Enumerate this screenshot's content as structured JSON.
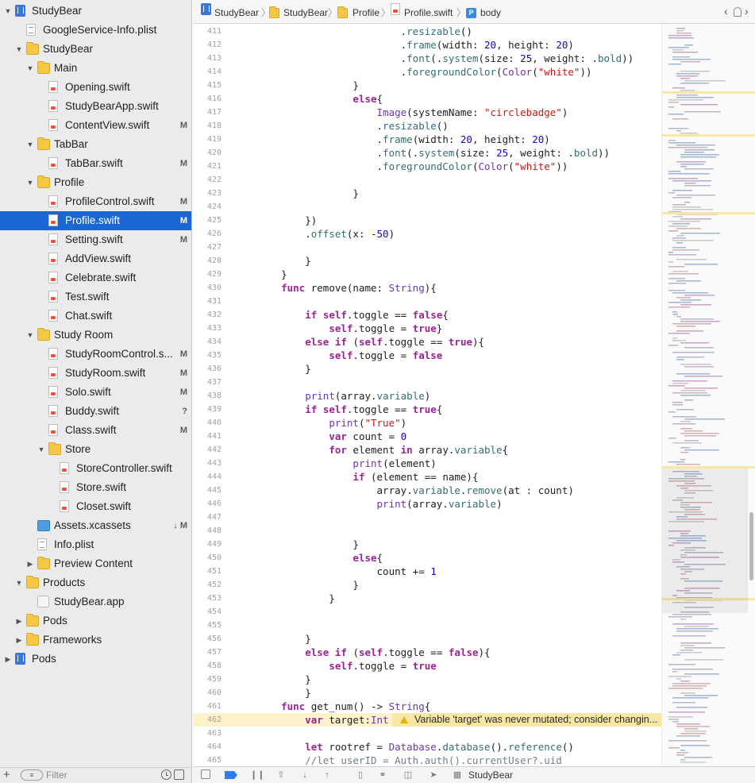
{
  "navigator": {
    "items": [
      {
        "label": "StudyBear",
        "icon": "project-icon",
        "status": "",
        "depth": 0,
        "disclosure": "open"
      },
      {
        "label": "GoogleService-Info.plist",
        "icon": "plist-icon",
        "status": "",
        "depth": 1,
        "disclosure": "none"
      },
      {
        "label": "StudyBear",
        "icon": "folder-icon",
        "status": "",
        "depth": 1,
        "disclosure": "open"
      },
      {
        "label": "Main",
        "icon": "folder-icon",
        "status": "",
        "depth": 2,
        "disclosure": "open"
      },
      {
        "label": "Opening.swift",
        "icon": "swift-file-icon",
        "status": "",
        "depth": 3,
        "disclosure": "none"
      },
      {
        "label": "StudyBearApp.swift",
        "icon": "swift-file-icon",
        "status": "",
        "depth": 3,
        "disclosure": "none"
      },
      {
        "label": "ContentView.swift",
        "icon": "swift-file-icon",
        "status": "M",
        "depth": 3,
        "disclosure": "none"
      },
      {
        "label": "TabBar",
        "icon": "folder-icon",
        "status": "",
        "depth": 2,
        "disclosure": "open"
      },
      {
        "label": "TabBar.swift",
        "icon": "swift-file-icon",
        "status": "M",
        "depth": 3,
        "disclosure": "none"
      },
      {
        "label": "Profile",
        "icon": "folder-icon",
        "status": "",
        "depth": 2,
        "disclosure": "open"
      },
      {
        "label": "ProfileControl.swift",
        "icon": "swift-file-icon",
        "status": "M",
        "depth": 3,
        "disclosure": "none"
      },
      {
        "label": "Profile.swift",
        "icon": "swift-file-icon",
        "status": "M",
        "depth": 3,
        "disclosure": "none",
        "selected": true
      },
      {
        "label": "Setting.swift",
        "icon": "swift-file-icon",
        "status": "M",
        "depth": 3,
        "disclosure": "none"
      },
      {
        "label": "AddView.swift",
        "icon": "swift-file-icon",
        "status": "",
        "depth": 3,
        "disclosure": "none"
      },
      {
        "label": "Celebrate.swift",
        "icon": "swift-file-icon",
        "status": "",
        "depth": 3,
        "disclosure": "none"
      },
      {
        "label": "Test.swift",
        "icon": "swift-file-icon",
        "status": "",
        "depth": 3,
        "disclosure": "none"
      },
      {
        "label": "Chat.swift",
        "icon": "swift-file-icon",
        "status": "",
        "depth": 3,
        "disclosure": "none"
      },
      {
        "label": "Study Room",
        "icon": "folder-icon",
        "status": "",
        "depth": 2,
        "disclosure": "open"
      },
      {
        "label": "StudyRoomControl.s...",
        "icon": "swift-file-icon",
        "status": "M",
        "depth": 3,
        "disclosure": "none"
      },
      {
        "label": "StudyRoom.swift",
        "icon": "swift-file-icon",
        "status": "M",
        "depth": 3,
        "disclosure": "none"
      },
      {
        "label": "Solo.swift",
        "icon": "swift-file-icon",
        "status": "M",
        "depth": 3,
        "disclosure": "none"
      },
      {
        "label": "Buddy.swift",
        "icon": "swift-file-icon",
        "status": "?",
        "depth": 3,
        "disclosure": "none"
      },
      {
        "label": "Class.swift",
        "icon": "swift-file-icon",
        "status": "M",
        "depth": 3,
        "disclosure": "none"
      },
      {
        "label": "Store",
        "icon": "folder-icon",
        "status": "",
        "depth": 3,
        "disclosure": "open"
      },
      {
        "label": "StoreController.swift",
        "icon": "swift-file-icon",
        "status": "",
        "depth": 4,
        "disclosure": "none"
      },
      {
        "label": "Store.swift",
        "icon": "swift-file-icon",
        "status": "",
        "depth": 4,
        "disclosure": "none"
      },
      {
        "label": "Closet.swift",
        "icon": "swift-file-icon",
        "status": "",
        "depth": 4,
        "disclosure": "none"
      },
      {
        "label": "Assets.xcassets",
        "icon": "assets-icon",
        "status": "↓ M",
        "depth": 2,
        "disclosure": "none"
      },
      {
        "label": "Info.plist",
        "icon": "plist-icon",
        "status": "",
        "depth": 2,
        "disclosure": "none"
      },
      {
        "label": "Preview Content",
        "icon": "folder-icon",
        "status": "",
        "depth": 2,
        "disclosure": "closed"
      },
      {
        "label": "Products",
        "icon": "folder-icon",
        "status": "",
        "depth": 1,
        "disclosure": "open"
      },
      {
        "label": "StudyBear.app",
        "icon": "app-icon",
        "status": "",
        "depth": 2,
        "disclosure": "none"
      },
      {
        "label": "Pods",
        "icon": "folder-icon",
        "status": "",
        "depth": 1,
        "disclosure": "closed"
      },
      {
        "label": "Frameworks",
        "icon": "folder-icon",
        "status": "",
        "depth": 1,
        "disclosure": "closed"
      },
      {
        "label": "Pods",
        "icon": "project-icon",
        "status": "",
        "depth": 0,
        "disclosure": "closed"
      }
    ],
    "footer": {
      "add_label": "+",
      "filter_label": "Filter"
    }
  },
  "jumpbar": {
    "crumbs": [
      {
        "label": "StudyBear",
        "icon": "project-icon"
      },
      {
        "label": "StudyBear",
        "icon": "folder-icon"
      },
      {
        "label": "Profile",
        "icon": "folder-icon"
      },
      {
        "label": "Profile.swift",
        "icon": "swift-file-icon"
      },
      {
        "label": "body",
        "icon": "property-icon"
      }
    ],
    "back": "‹",
    "forward": "›"
  },
  "editor": {
    "lines": [
      {
        "n": "411",
        "code": "                        .resizable()"
      },
      {
        "n": "412",
        "code": "                        .frame(width: 20, height: 20)"
      },
      {
        "n": "413",
        "code": "                        .font(.system(size: 25, weight: .bold))"
      },
      {
        "n": "414",
        "code": "                        .foregroundColor(Color(\"white\"))"
      },
      {
        "n": "415",
        "code": "                }"
      },
      {
        "n": "416",
        "code": "                else{"
      },
      {
        "n": "417",
        "code": "                    Image(systemName: \"circlebadge\")"
      },
      {
        "n": "418",
        "code": "                    .resizable()"
      },
      {
        "n": "419",
        "code": "                    .frame(width: 20, height: 20)"
      },
      {
        "n": "420",
        "code": "                    .font(.system(size: 25, weight: .bold))"
      },
      {
        "n": "421",
        "code": "                    .foregroundColor(Color(\"white\"))"
      },
      {
        "n": "422",
        "code": ""
      },
      {
        "n": "423",
        "code": "                }"
      },
      {
        "n": "424",
        "code": ""
      },
      {
        "n": "425",
        "code": "        })"
      },
      {
        "n": "426",
        "code": "        .offset(x: -50)"
      },
      {
        "n": "427",
        "code": ""
      },
      {
        "n": "428",
        "code": "        }"
      },
      {
        "n": "429",
        "code": "    }"
      },
      {
        "n": "430",
        "code": "    func remove(name: String){"
      },
      {
        "n": "431",
        "code": ""
      },
      {
        "n": "432",
        "code": "        if self.toggle == false{"
      },
      {
        "n": "433",
        "code": "            self.toggle = true}"
      },
      {
        "n": "434",
        "code": "        else if (self.toggle == true){"
      },
      {
        "n": "435",
        "code": "            self.toggle = false"
      },
      {
        "n": "436",
        "code": "        }"
      },
      {
        "n": "437",
        "code": ""
      },
      {
        "n": "438",
        "code": "        print(array.variable)"
      },
      {
        "n": "439",
        "code": "        if self.toggle == true{"
      },
      {
        "n": "440",
        "code": "            print(\"True\")"
      },
      {
        "n": "441",
        "code": "            var count = 0"
      },
      {
        "n": "442",
        "code": "            for element in array.variable{"
      },
      {
        "n": "443",
        "code": "                print(element)"
      },
      {
        "n": "444",
        "code": "                if (element == name){"
      },
      {
        "n": "445",
        "code": "                    array.variable.remove(at : count)"
      },
      {
        "n": "446",
        "code": "                    print(array.variable)"
      },
      {
        "n": "447",
        "code": ""
      },
      {
        "n": "448",
        "code": ""
      },
      {
        "n": "449",
        "code": "                }"
      },
      {
        "n": "450",
        "code": "                else{"
      },
      {
        "n": "451",
        "code": "                    count += 1"
      },
      {
        "n": "452",
        "code": "                }"
      },
      {
        "n": "453",
        "code": "            }"
      },
      {
        "n": "454",
        "code": ""
      },
      {
        "n": "455",
        "code": ""
      },
      {
        "n": "456",
        "code": "        }"
      },
      {
        "n": "457",
        "code": "        else if (self.toggle == false){"
      },
      {
        "n": "458",
        "code": "            self.toggle = true"
      },
      {
        "n": "459",
        "code": "        }"
      },
      {
        "n": "460",
        "code": "        }"
      },
      {
        "n": "461",
        "code": "    func get_num() -> String{"
      },
      {
        "n": "462",
        "code": "        var target:Int = 0",
        "warning": "Variable 'target' was never mutated; consider changin..."
      },
      {
        "n": "463",
        "code": ""
      },
      {
        "n": "464",
        "code": "        let rootref = Database.database().reference()"
      },
      {
        "n": "465",
        "code": "        //let userID = Auth.auth().currentUser?.uid"
      }
    ]
  },
  "debug_bar": {
    "scheme": "StudyBear"
  },
  "colors": {
    "selection": "#1a66d2",
    "keyword": "#9b2393",
    "string": "#c41a16",
    "number": "#1c00cf",
    "warning": "#f8e6a4",
    "folder": "#f6c744"
  }
}
